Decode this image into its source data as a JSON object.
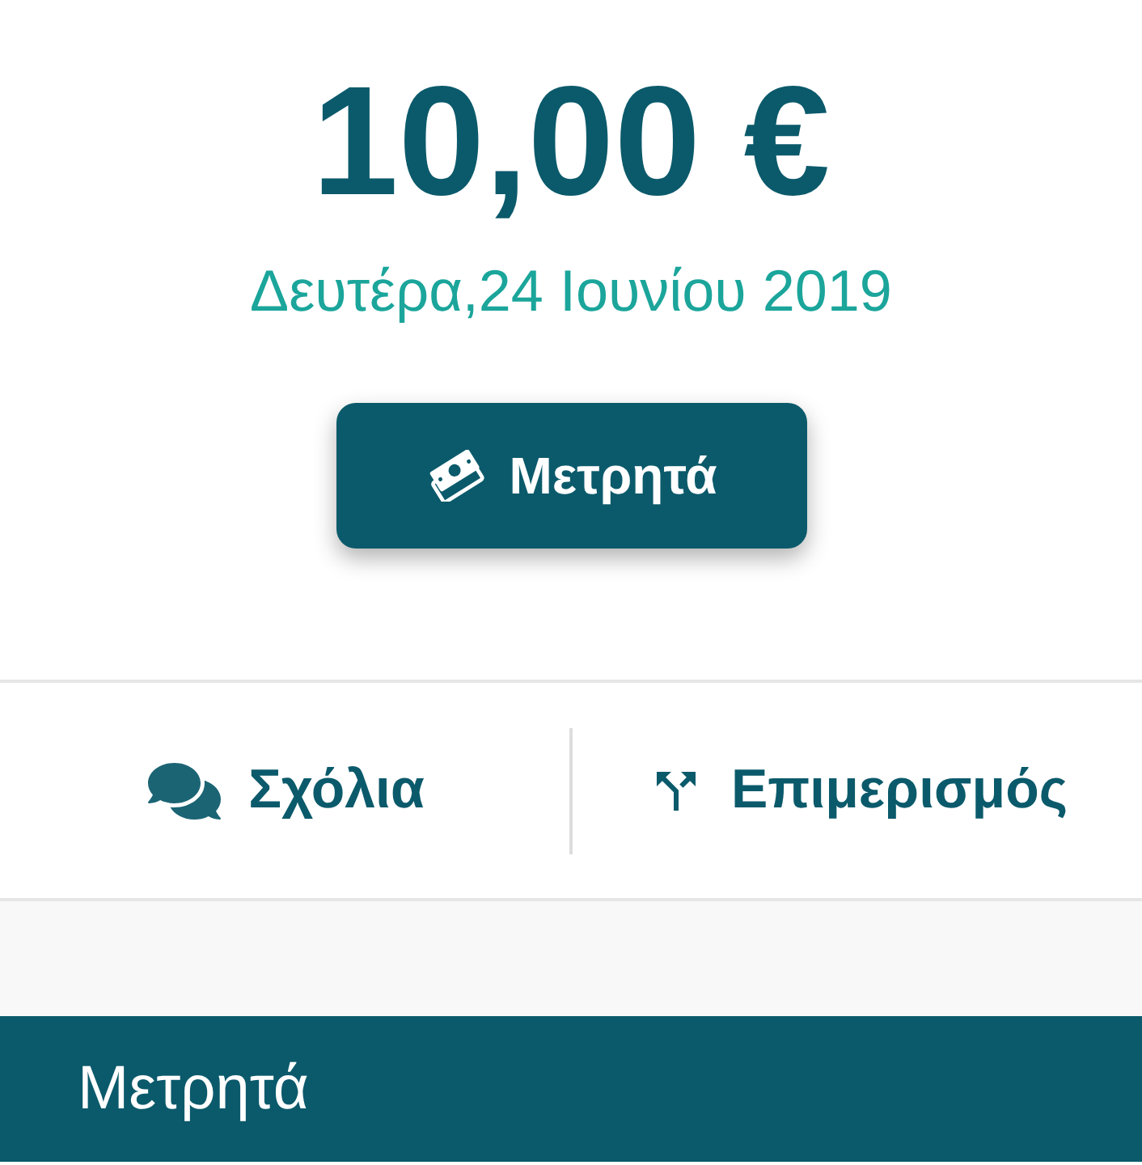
{
  "amount": "10,00 €",
  "date": "Δευτέρα,24 Ιουνίου 2019",
  "payment_button": {
    "label": "Μετρητά"
  },
  "actions": [
    {
      "kind": "comments",
      "label": "Σχόλια"
    },
    {
      "kind": "split",
      "label": "Επιμερισμός"
    }
  ],
  "section_header": {
    "title": "Μετρητά"
  }
}
